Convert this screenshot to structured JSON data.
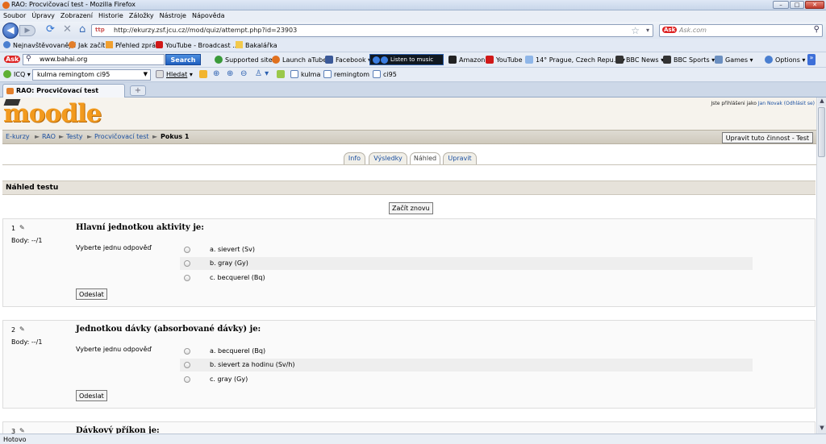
{
  "window": {
    "title": "RAO: Procvičovací test - Mozilla Firefox",
    "min": "–",
    "max": "□",
    "close": "✕"
  },
  "menu": [
    "Soubor",
    "Úpravy",
    "Zobrazení",
    "Historie",
    "Záložky",
    "Nástroje",
    "Nápověda"
  ],
  "nav": {
    "url": "http://ekurzy.zsf.jcu.cz//mod/quiz/attempt.php?id=23903",
    "search_placeholder": "Ask.com",
    "back_icon": "arrow-left-icon",
    "reload_icon": "reload-icon",
    "stop_icon": "stop-icon",
    "home_icon": "home-icon"
  },
  "bookmarks": [
    "Nejnavštěvovanější",
    "Jak začít",
    "Přehled zpráv",
    "YouTube - Broadcast ...",
    "Bakalářka"
  ],
  "asktoolbar": {
    "input": "www.bahai.org",
    "search_button": "Search",
    "items": [
      "Supported sites",
      "Launch aTube",
      "Facebook",
      "Listen to music",
      "Amazon",
      "YouTube",
      "14° Prague, Czech Repu...",
      "BBC News",
      "BBC Sports",
      "Games",
      "Options"
    ]
  },
  "icqbar": {
    "icq": "ICQ",
    "select": "kulma remingtom ci95",
    "find": "Hledat",
    "links": [
      "kulma",
      "remingtom",
      "ci95"
    ]
  },
  "tabs": {
    "active": "RAO: Procvičovací test",
    "new": "+"
  },
  "page": {
    "logo": "moodle",
    "login_prefix": "Jste přihlášeni jako",
    "login_user": "Jan Novak",
    "logout": "(Odhlásit se)",
    "breadcrumb": [
      "E-kurzy",
      "RAO",
      "Testy",
      "Procvičovací test",
      "Pokus 1"
    ],
    "edit_button": "Upravit tuto činnost - Test",
    "module_tabs": [
      "Info",
      "Výsledky",
      "Náhled",
      "Upravit"
    ],
    "section_title": "Náhled testu",
    "restart_button": "Začít znovu"
  },
  "questions": [
    {
      "num": "1",
      "points": "Body: --/1",
      "text": "Hlavní jednotkou aktivity je:",
      "prompt": "Vyberte jednu odpověď",
      "options": [
        "a. sievert (Sv)",
        "b. gray (Gy)",
        "c. becquerel (Bq)"
      ],
      "submit": "Odeslat"
    },
    {
      "num": "2",
      "points": "Body: --/1",
      "text": "Jednotkou dávky (absorbované dávky) je:",
      "prompt": "Vyberte jednu odpověď",
      "options": [
        "a. becquerel (Bq)",
        "b. sievert za hodinu (Sv/h)",
        "c. gray (Gy)"
      ],
      "submit": "Odeslat"
    },
    {
      "num": "3",
      "text": "Dávkový příkon je:"
    }
  ],
  "status": "Hotovo"
}
